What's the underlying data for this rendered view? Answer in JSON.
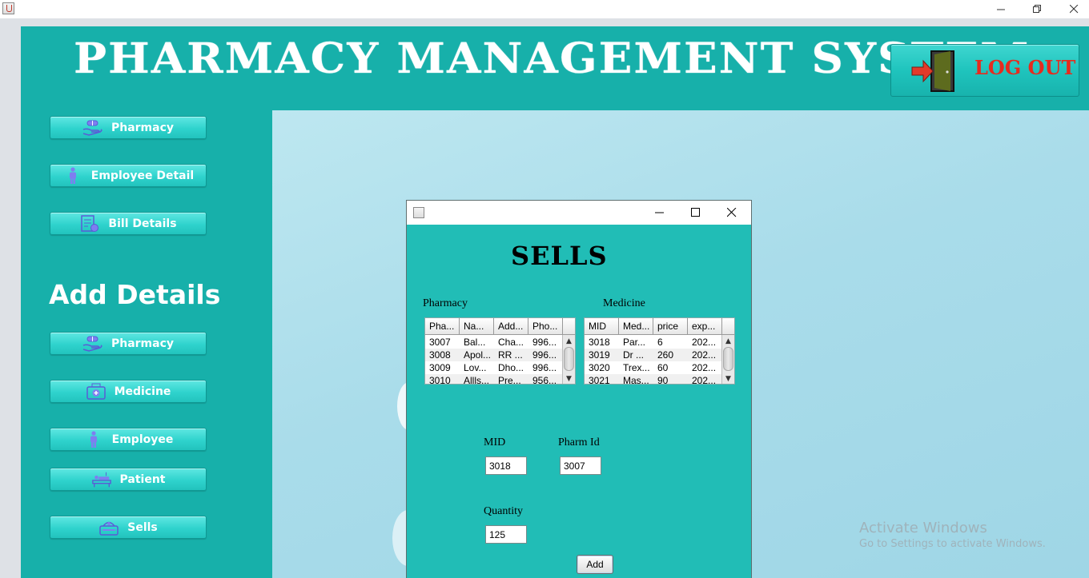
{
  "window": {
    "minimize_icon": "minimize-icon",
    "restore_icon": "restore-icon",
    "close_icon": "close-icon"
  },
  "app": {
    "title": "PHARMACY MANAGEMENT SYSTEM",
    "logout_label": "LOG OUT",
    "logout_icon": "exit-door-icon",
    "accent": "#17b0aa",
    "logout_color": "#e62b1e"
  },
  "sidebar": {
    "top_items": [
      {
        "label": "Pharmacy",
        "icon": "pill-hand-icon"
      },
      {
        "label": "Employee Detail",
        "icon": "person-icon"
      },
      {
        "label": "Bill Details",
        "icon": "bill-icon"
      }
    ],
    "section_title": "Add Details",
    "add_items": [
      {
        "label": "Pharmacy",
        "icon": "pill-hand-icon"
      },
      {
        "label": "Medicine",
        "icon": "medicine-box-icon"
      },
      {
        "label": "Employee",
        "icon": "person-icon"
      },
      {
        "label": "Patient",
        "icon": "patient-bed-icon"
      },
      {
        "label": "Sells",
        "icon": "cart-icon"
      }
    ]
  },
  "watermark": {
    "line1": "Activate Windows",
    "line2": "Go to Settings to activate Windows."
  },
  "dialog": {
    "title": "SELLS",
    "pharmacy_label": "Pharmacy",
    "medicine_label": "Medicine",
    "pharmacy_table": {
      "columns": [
        "Pha...",
        "Na...",
        "Add...",
        "Pho..."
      ],
      "rows": [
        [
          "3007",
          "Bal...",
          "Cha...",
          "996..."
        ],
        [
          "3008",
          "Apol...",
          "RR ...",
          "996..."
        ],
        [
          "3009",
          "Lov...",
          "Dho...",
          "996..."
        ],
        [
          "3010",
          "Allls...",
          "Pre...",
          "956..."
        ]
      ]
    },
    "medicine_table": {
      "columns": [
        "MID",
        "Med...",
        "price",
        "exp..."
      ],
      "rows": [
        [
          "3018",
          "Par...",
          "6",
          "202..."
        ],
        [
          "3019",
          "Dr ...",
          "260",
          "202..."
        ],
        [
          "3020",
          "Trex...",
          "60",
          "202..."
        ],
        [
          "3021",
          "Mas...",
          "90",
          "202..."
        ]
      ]
    },
    "mid_label": "MID",
    "mid_value": "3018",
    "pharm_id_label": "Pharm Id",
    "pharm_id_value": "3007",
    "quantity_label": "Quantity",
    "quantity_value": "125",
    "add_label": "Add"
  }
}
